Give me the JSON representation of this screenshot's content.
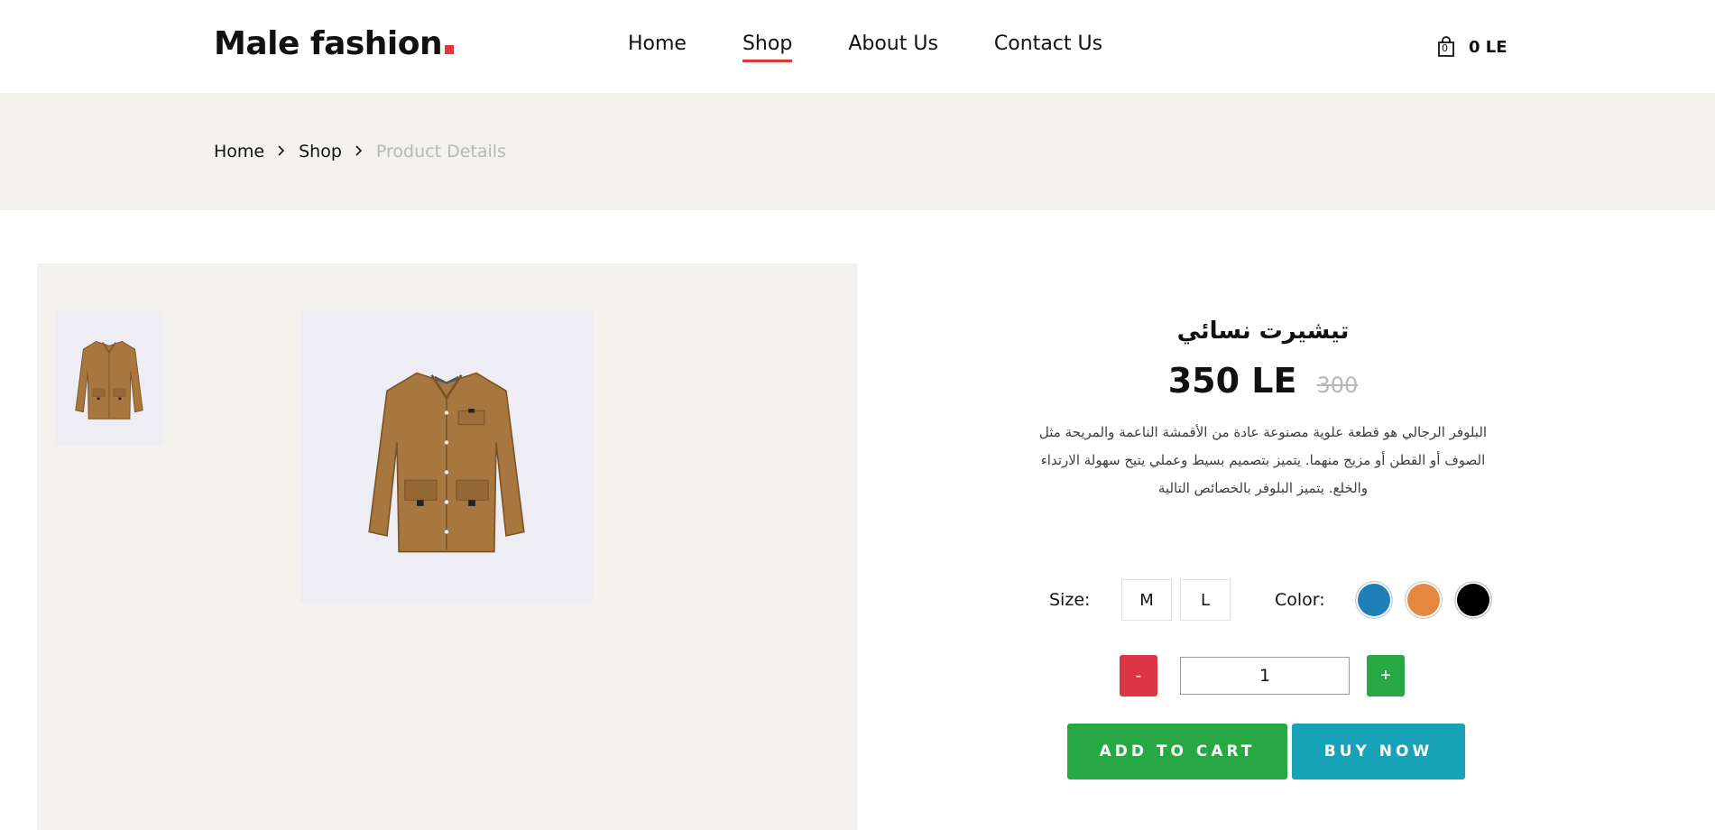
{
  "header": {
    "logo_text": "Male fashion",
    "logo_accent_color": "#e53637",
    "nav": [
      {
        "label": "Home",
        "active": false
      },
      {
        "label": "Shop",
        "active": true
      },
      {
        "label": "About Us",
        "active": false
      },
      {
        "label": "Contact Us",
        "active": false
      }
    ],
    "cart": {
      "icon": "shopping-bag-icon",
      "count": "0",
      "total": "0 LE"
    }
  },
  "breadcrumb": {
    "items": [
      "Home",
      "Shop"
    ],
    "current": "Product Details",
    "separator_icon": "chevron-right-icon"
  },
  "gallery": {
    "thumbnail": "brown-jacket-thumbnail",
    "main_image": "brown-jacket-image"
  },
  "product": {
    "title": "تيشيرت نسائي",
    "price": "350 LE",
    "old_price": "300",
    "description": "البلوفر الرجالي هو قطعة علوية مصنوعة عادة من الأقمشة الناعمة والمريحة مثل الصوف أو القطن أو مزيج منهما. يتميز بتصميم بسيط وعملي يتيح سهولة الارتداء والخلع. يتميز البلوفر بالخصائص التالية",
    "size_label": "Size:",
    "sizes": [
      "M",
      "L"
    ],
    "color_label": "Color:",
    "colors": [
      "#1f7fb8",
      "#e5883f",
      "#000000"
    ],
    "quantity": {
      "minus": "-",
      "value": "1",
      "plus": "+"
    },
    "add_to_cart_label": "ADD TO CART",
    "buy_now_label": "BUY NOW",
    "button_colors": {
      "add_to_cart": "#28a745",
      "buy_now": "#17a2b8",
      "minus": "#dc3545",
      "plus": "#28a745"
    }
  }
}
